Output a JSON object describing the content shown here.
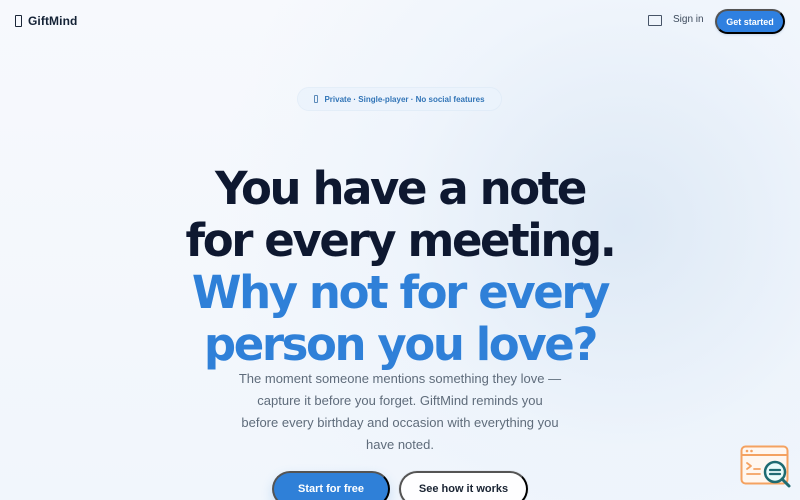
{
  "header": {
    "brand_name": "GiftMind",
    "icons": {
      "brand": "gift-icon",
      "theme_toggle": "theme-toggle-icon"
    },
    "sign_in_label": "Sign in",
    "get_started_label": "Get started"
  },
  "hero": {
    "badge_icon": "lock-icon",
    "badge_text": "Private · Single-player · No social features",
    "headline_lines": [
      "You have a note",
      "for every meeting.",
      "Why not for every",
      "person you love?"
    ],
    "subtitle_lines": [
      "The moment someone mentions something they love —",
      "capture it before you forget. GiftMind reminds you",
      "before every birthday and occasion with everything you",
      "have noted."
    ],
    "primary_button_label": "Start for free",
    "secondary_button_label": "See how it works"
  },
  "widgets": {
    "support_icon": "help-chat-icon"
  },
  "colors": {
    "accent": "#2f80d8",
    "headline_dark": "#0e1830",
    "text_muted": "#5f6c7b",
    "badge_text": "#3275b7",
    "widget_orange": "#f4a261",
    "widget_teal": "#1e6b72"
  }
}
